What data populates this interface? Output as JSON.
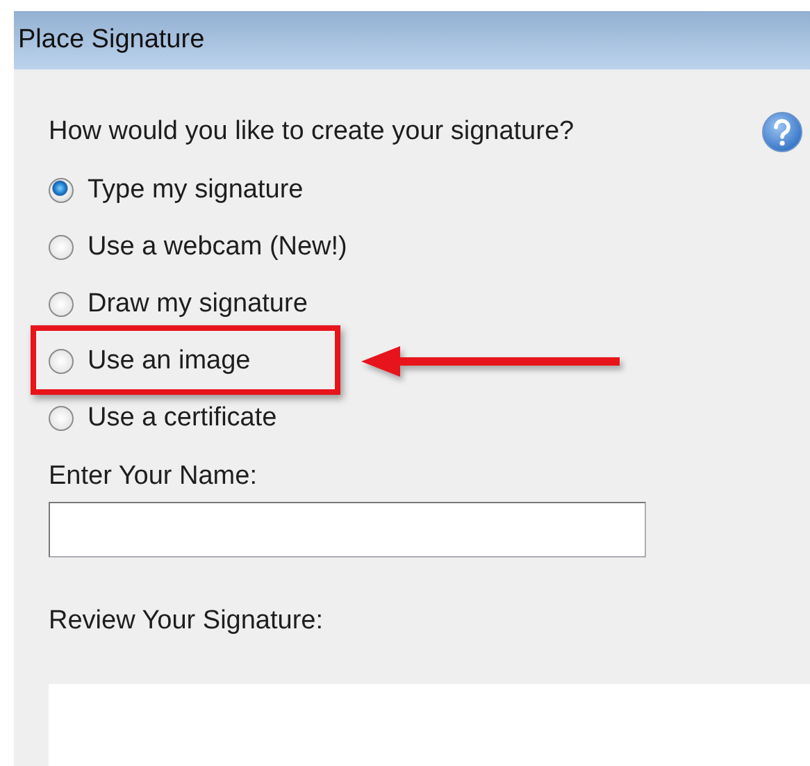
{
  "window": {
    "title": "Place Signature"
  },
  "question": "How would you like to create your signature?",
  "options": [
    {
      "label": "Type my signature",
      "selected": true,
      "highlighted": false
    },
    {
      "label": "Use a webcam (New!)",
      "selected": false,
      "highlighted": false
    },
    {
      "label": "Draw my signature",
      "selected": false,
      "highlighted": false
    },
    {
      "label": "Use an image",
      "selected": false,
      "highlighted": true
    },
    {
      "label": "Use a certificate",
      "selected": false,
      "highlighted": false
    }
  ],
  "name_field": {
    "label": "Enter Your Name:"
  },
  "review": {
    "label": "Review Your Signature:"
  }
}
